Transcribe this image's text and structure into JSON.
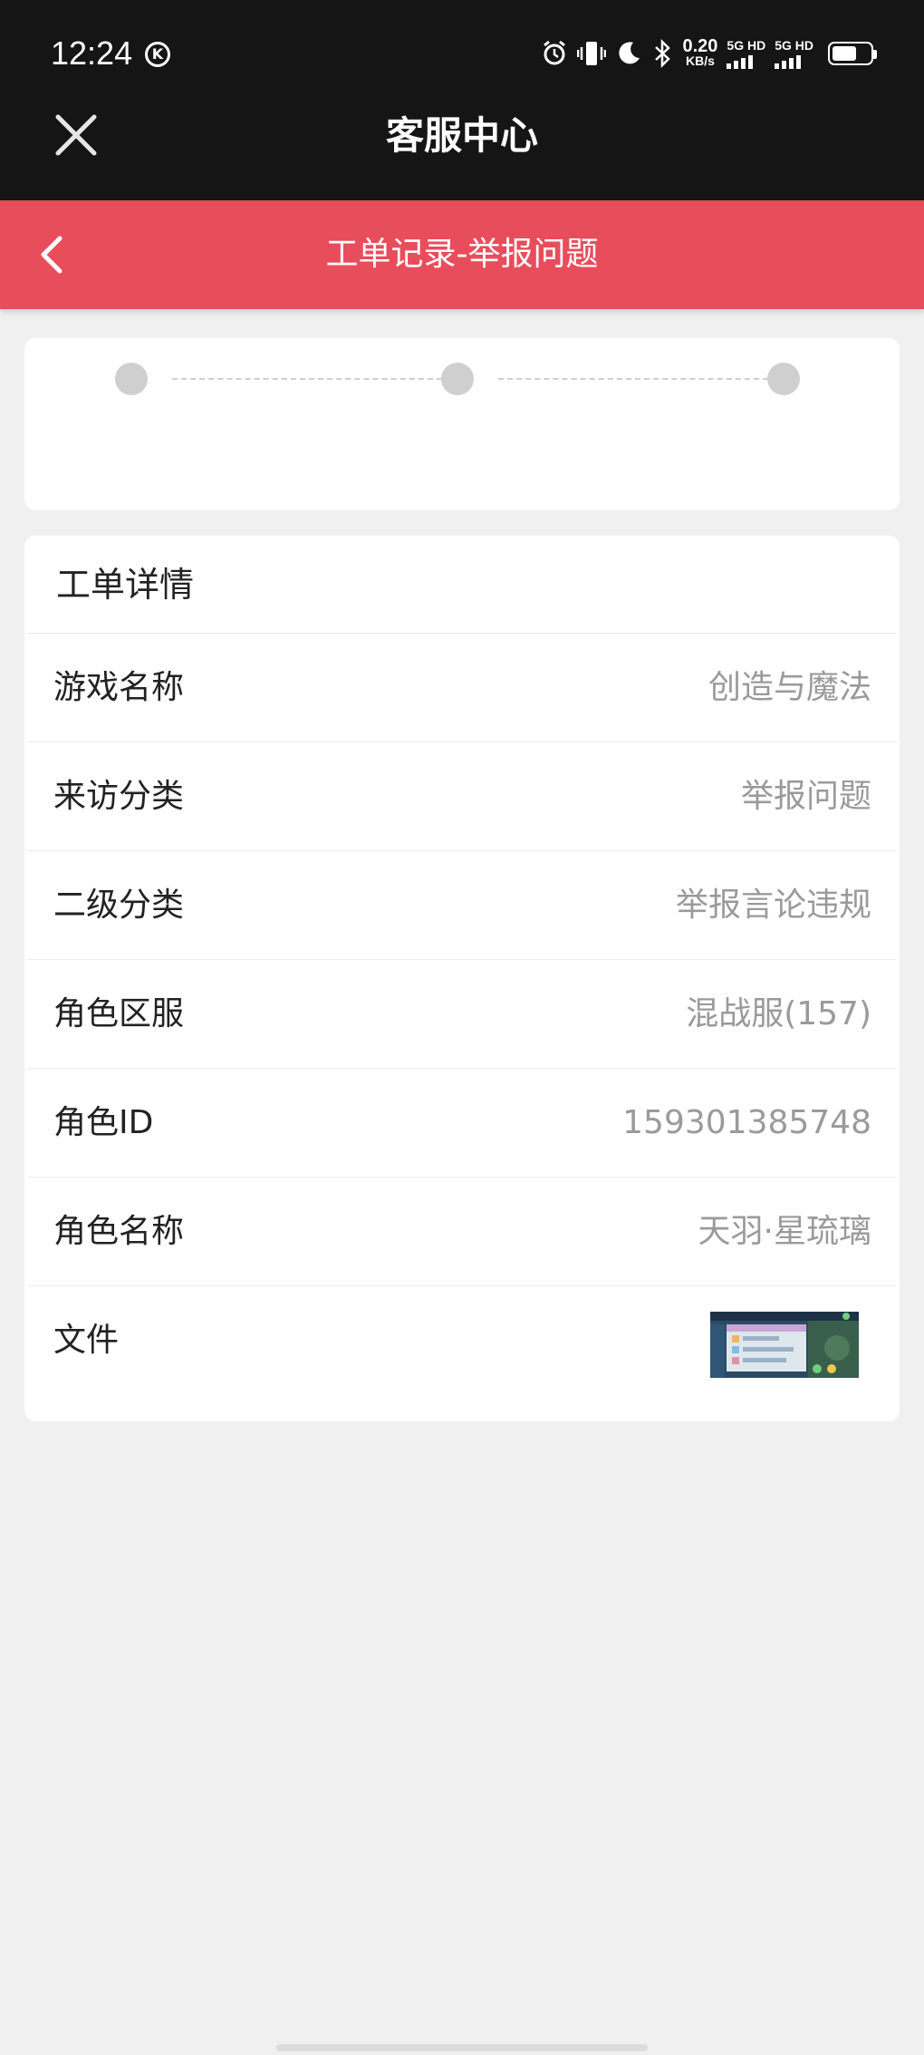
{
  "status": {
    "time": "12:24",
    "k_badge": "K",
    "net_speed": "0.20",
    "net_unit": "KB/s",
    "sim1": "5G HD",
    "sim2": "5G HD"
  },
  "topbar": {
    "title": "客服中心"
  },
  "subbar": {
    "title": "工单记录-举报问题"
  },
  "progress": {
    "steps": 3
  },
  "detail": {
    "header": "工单详情",
    "rows": [
      {
        "label": "游戏名称",
        "value": "创造与魔法"
      },
      {
        "label": "来访分类",
        "value": "举报问题"
      },
      {
        "label": "二级分类",
        "value": "举报言论违规"
      },
      {
        "label": "角色区服",
        "value": "混战服(157)"
      },
      {
        "label": "角色ID",
        "value": "159301385748"
      },
      {
        "label": "角色名称",
        "value": "天羽·星琉璃"
      }
    ],
    "file_label": "文件"
  },
  "colors": {
    "accent": "#e84d5b",
    "topbar": "#151515",
    "background": "#f0f0f0"
  }
}
